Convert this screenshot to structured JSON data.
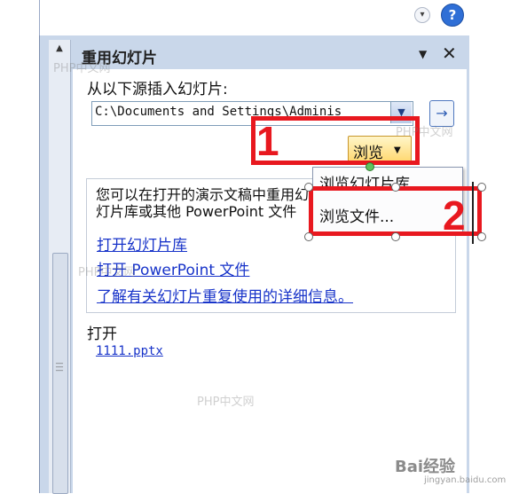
{
  "topbar": {
    "dropdown_icon": "chevron-down-circle-icon",
    "help_label": "?"
  },
  "pane": {
    "title": "重用幻灯片",
    "menu_glyph": "▼",
    "close_glyph": "✕",
    "source_label": "从以下源插入幻灯片:",
    "path_value": "C:\\Documents and Settings\\Adminis",
    "path_dropdown_glyph": "▼",
    "go_glyph": "→",
    "browse_label": "浏览",
    "browse_caret": "▼",
    "browse_menu": [
      "浏览幻灯片库",
      "浏览文件..."
    ],
    "info_text": "您可以在打开的演示文稿中重用幻灯片库或其他 PowerPoint 文件",
    "links": [
      "打开幻灯片库",
      "打开 PowerPoint 文件",
      "了解有关幻灯片重复使用的详细信息。"
    ],
    "open_title": "打开",
    "recent_file": "1111.pptx"
  },
  "annotations": {
    "step1": "1",
    "step2": "2"
  },
  "watermarks": {
    "site": "PHP中文网",
    "baidu": "Bai经验",
    "baidu_sub": "jingyan.baidu.com"
  },
  "colors": {
    "accent_red": "#e8181f",
    "link_blue": "#1733c9",
    "pane_blue": "#c9d7ea"
  }
}
